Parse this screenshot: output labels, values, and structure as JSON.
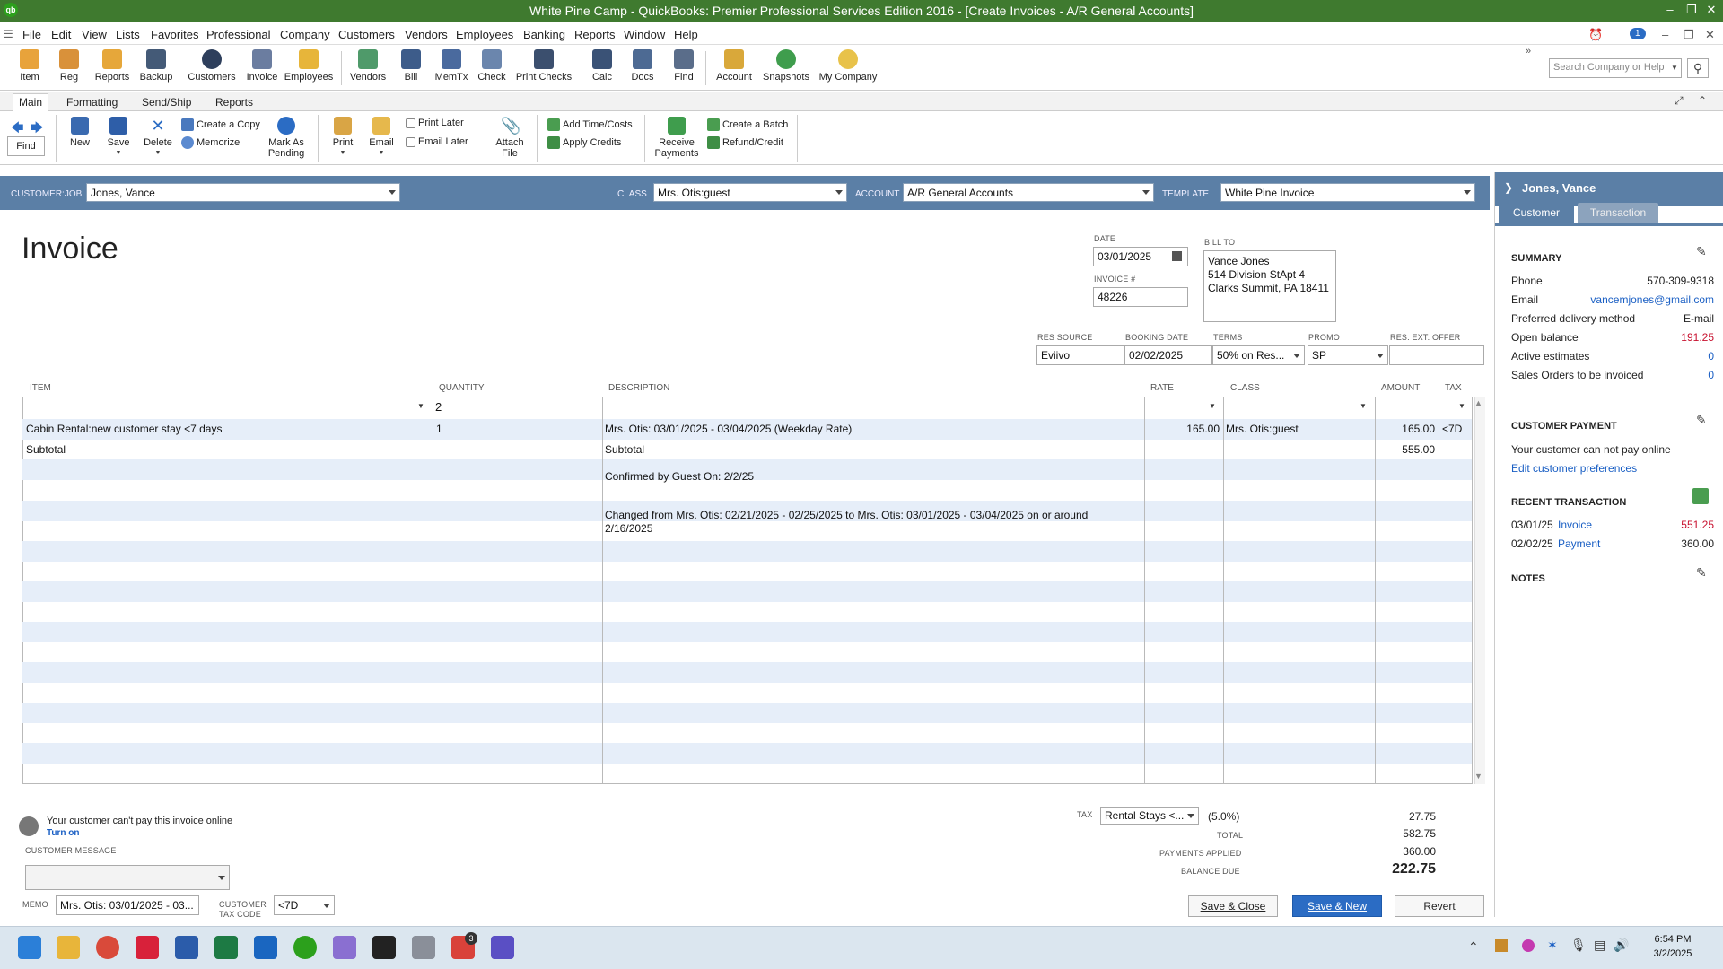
{
  "window": {
    "title": "White Pine Camp  - QuickBooks: Premier Professional Services Edition 2016 - [Create Invoices - A/R General Accounts]",
    "logo": "qb",
    "alert_count": "1"
  },
  "menu": [
    "File",
    "Edit",
    "View",
    "Lists",
    "Favorites",
    "Professional",
    "Company",
    "Customers",
    "Vendors",
    "Employees",
    "Banking",
    "Reports",
    "Window",
    "Help"
  ],
  "iconbar": [
    "Item",
    "Reg",
    "Reports",
    "Backup",
    "Customers",
    "Invoice",
    "Employees",
    "Vendors",
    "Bill",
    "MemTx",
    "Check",
    "Print Checks",
    "Calc",
    "Docs",
    "Find",
    "Account",
    "Snapshots",
    "My Company"
  ],
  "search": {
    "placeholder": "Search Company or Help"
  },
  "form_tabs": [
    "Main",
    "Formatting",
    "Send/Ship",
    "Reports"
  ],
  "ribbon": {
    "find": "Find",
    "new": "New",
    "save": "Save",
    "delete": "Delete",
    "create_copy": "Create a Copy",
    "memorize": "Memorize",
    "mark_pending_1": "Mark As",
    "mark_pending_2": "Pending",
    "print": "Print",
    "email": "Email",
    "print_later": "Print Later",
    "email_later": "Email Later",
    "attach_1": "Attach",
    "attach_2": "File",
    "add_time": "Add Time/Costs",
    "apply_credits": "Apply Credits",
    "receive_1": "Receive",
    "receive_2": "Payments",
    "create_batch": "Create a Batch",
    "refund": "Refund/Credit"
  },
  "header": {
    "customer_label": "CUSTOMER:JOB",
    "customer": "Jones, Vance",
    "class_label": "CLASS",
    "class": "Mrs. Otis:guest",
    "account_label": "ACCOUNT",
    "account": "A/R General Accounts",
    "template_label": "TEMPLATE",
    "template": "White Pine Invoice"
  },
  "invoice": {
    "title": "Invoice",
    "date_label": "DATE",
    "date": "03/01/2025",
    "number_label": "INVOICE #",
    "number": "48226",
    "bill_to_label": "BILL TO",
    "bill_to": [
      "Vance Jones",
      "514 Division StApt 4",
      "Clarks Summit, PA 18411"
    ],
    "res_source_label": "RES SOURCE",
    "res_source": "Eviivo",
    "booking_date_label": "BOOKING DATE",
    "booking_date": "02/02/2025",
    "terms_label": "TERMS",
    "terms": "50% on Res...",
    "promo_label": "PROMO",
    "promo": "SP",
    "res_ext_label": "RES. EXT. OFFER",
    "res_ext": ""
  },
  "columns": [
    "ITEM",
    "QUANTITY",
    "DESCRIPTION",
    "RATE",
    "CLASS",
    "AMOUNT",
    "TAX"
  ],
  "lines": {
    "edit_qty": "2",
    "r1_item": "Cabin Rental:new customer stay <7 days",
    "r1_qty": "1",
    "r1_desc": "Mrs. Otis: 03/01/2025 - 03/04/2025 (Weekday Rate)",
    "r1_rate": "165.00",
    "r1_class": "Mrs. Otis:guest",
    "r1_amount": "165.00",
    "r1_tax": "<7D",
    "r2_item": "Subtotal",
    "r2_desc": "Subtotal",
    "r2_amount": "555.00",
    "r3_desc": "Confirmed by Guest On: 2/2/25",
    "r4_desc_1": "Changed from Mrs. Otis: 02/21/2025 - 02/25/2025 to Mrs. Otis: 03/01/2025 - 03/04/2025 on or around",
    "r4_desc_2": "2/16/2025"
  },
  "footer": {
    "online_msg": "Your customer can't pay this invoice online",
    "turn_on": "Turn on",
    "cust_msg_label": "CUSTOMER MESSAGE",
    "memo_label": "MEMO",
    "memo": "Mrs. Otis: 03/01/2025 - 03...",
    "tax_code_label_1": "CUSTOMER",
    "tax_code_label_2": "TAX CODE",
    "tax_code": "<7D",
    "tax_label": "TAX",
    "tax_item": "Rental Stays <...",
    "tax_pct": "(5.0%)",
    "tax_amount": "27.75",
    "total_label": "TOTAL",
    "total": "582.75",
    "payments_label": "PAYMENTS APPLIED",
    "payments": "360.00",
    "balance_label": "BALANCE DUE",
    "balance": "222.75",
    "save_close": "Save & Close",
    "save_new": "Save & New",
    "revert": "Revert"
  },
  "side": {
    "name": "Jones, Vance",
    "tab_customer": "Customer",
    "tab_transaction": "Transaction",
    "summary": "SUMMARY",
    "phone_label": "Phone",
    "phone": "570-309-9318",
    "email_label": "Email",
    "email": "vancemjones@gmail.com",
    "delivery_label": "Preferred delivery method",
    "delivery": "E-mail",
    "open_label": "Open balance",
    "open": "191.25",
    "estimates_label": "Active estimates",
    "estimates": "0",
    "so_label": "Sales Orders to be invoiced",
    "so": "0",
    "cp_header": "CUSTOMER PAYMENT",
    "cp_text": "Your customer can not pay online",
    "cp_link": "Edit customer preferences",
    "rt_header": "RECENT TRANSACTION",
    "rt1_date": "03/01/25",
    "rt1_type": "Invoice",
    "rt1_amount": "551.25",
    "rt2_date": "02/02/25",
    "rt2_type": "Payment",
    "rt2_amount": "360.00",
    "notes": "NOTES"
  },
  "tray": {
    "time": "6:54 PM",
    "date": "3/2/2025",
    "badge": "3"
  },
  "colors": {
    "title_green": "#3f7a2f",
    "header_blue": "#5b7fa6",
    "stripe": "#e6eef9",
    "primary": "#2b6cc4",
    "negative": "#c8102e"
  }
}
